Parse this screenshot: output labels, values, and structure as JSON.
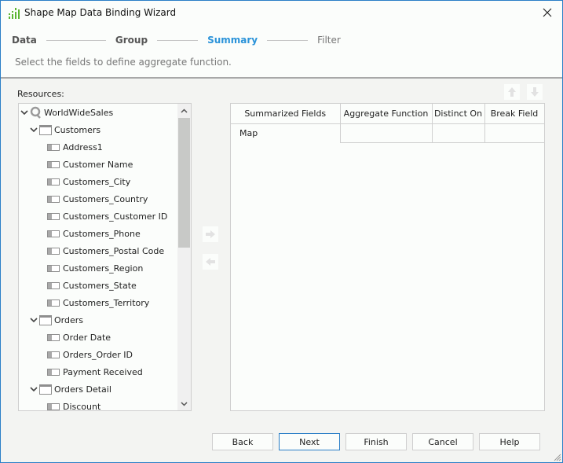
{
  "window": {
    "title": "Shape Map Data Binding Wizard",
    "icon": "chart-bars-icon",
    "close_icon": "close-icon"
  },
  "steps": [
    {
      "label": "Data",
      "state": "done"
    },
    {
      "label": "Group",
      "state": "done"
    },
    {
      "label": "Summary",
      "state": "active"
    },
    {
      "label": "Filter",
      "state": "future"
    }
  ],
  "subtitle": "Select the fields to define aggregate function.",
  "resources": {
    "label": "Resources:",
    "tree": [
      {
        "label": "WorldWideSales",
        "type": "query",
        "level": 0,
        "expanded": true
      },
      {
        "label": "Customers",
        "type": "table",
        "level": 1,
        "expanded": true
      },
      {
        "label": "Address1",
        "type": "field",
        "level": 2
      },
      {
        "label": "Customer Name",
        "type": "field",
        "level": 2
      },
      {
        "label": "Customers_City",
        "type": "field",
        "level": 2
      },
      {
        "label": "Customers_Country",
        "type": "field",
        "level": 2
      },
      {
        "label": "Customers_Customer ID",
        "type": "field",
        "level": 2
      },
      {
        "label": "Customers_Phone",
        "type": "field",
        "level": 2
      },
      {
        "label": "Customers_Postal Code",
        "type": "field",
        "level": 2
      },
      {
        "label": "Customers_Region",
        "type": "field",
        "level": 2
      },
      {
        "label": "Customers_State",
        "type": "field",
        "level": 2
      },
      {
        "label": "Customers_Territory",
        "type": "field",
        "level": 2
      },
      {
        "label": "Orders",
        "type": "table",
        "level": 1,
        "expanded": true
      },
      {
        "label": "Order Date",
        "type": "field",
        "level": 2
      },
      {
        "label": "Orders_Order ID",
        "type": "field",
        "level": 2
      },
      {
        "label": "Payment Received",
        "type": "field",
        "level": 2
      },
      {
        "label": "Orders Detail",
        "type": "table",
        "level": 1,
        "expanded": true
      },
      {
        "label": "Discount",
        "type": "field",
        "level": 2
      }
    ]
  },
  "move_buttons": {
    "add": "arrow-right-icon",
    "remove": "arrow-left-icon",
    "up": "arrow-up-icon",
    "down": "arrow-down-icon"
  },
  "summary_table": {
    "columns": [
      "Summarized Fields",
      "Aggregate Function",
      "Distinct On",
      "Break Field"
    ],
    "rows": [
      [
        "Map",
        "",
        "",
        ""
      ]
    ]
  },
  "buttons": {
    "back": "Back",
    "next": "Next",
    "finish": "Finish",
    "cancel": "Cancel",
    "help": "Help"
  },
  "colors": {
    "accent": "#2b93d9",
    "border_accent": "#2b7fc7",
    "app_icon": "#5cb531"
  }
}
